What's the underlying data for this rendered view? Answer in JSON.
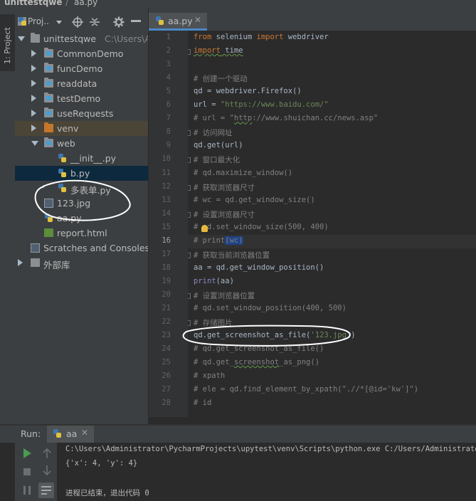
{
  "breadcrumb": {
    "project": "unittestqwe",
    "file": "aa.py"
  },
  "tool_strip": {
    "project_tab": "1: Project"
  },
  "project_panel": {
    "dropdown_label": "Proj..",
    "tree": [
      {
        "label": "unittestqwe",
        "sub": "C:\\Users\\Ad",
        "type": "folder",
        "level": 0,
        "expanded": true
      },
      {
        "label": "CommonDemo",
        "type": "package",
        "level": 1,
        "expanded": false
      },
      {
        "label": "funcDemo",
        "type": "package",
        "level": 1,
        "expanded": false
      },
      {
        "label": "readdata",
        "type": "package",
        "level": 1,
        "expanded": false
      },
      {
        "label": "testDemo",
        "type": "package",
        "level": 1,
        "expanded": false
      },
      {
        "label": "useRequests",
        "type": "package",
        "level": 1,
        "expanded": false
      },
      {
        "label": "venv",
        "type": "venv",
        "level": 1,
        "expanded": false
      },
      {
        "label": "web",
        "type": "package",
        "level": 1,
        "expanded": true
      },
      {
        "label": "__init__.py",
        "type": "py",
        "level": 2
      },
      {
        "label": "b.py",
        "type": "py",
        "level": 2,
        "selected": true
      },
      {
        "label": "多表单.py",
        "type": "py",
        "level": 2
      },
      {
        "label": "123.jpg",
        "type": "image",
        "level": 1
      },
      {
        "label": "aa.py",
        "type": "py",
        "level": 1
      },
      {
        "label": "report.html",
        "type": "html",
        "level": 1
      },
      {
        "label": "Scratches and Consoles",
        "type": "scratch",
        "level": 0
      },
      {
        "label": "外部库",
        "type": "lib",
        "level": 0,
        "expanded": false
      }
    ]
  },
  "editor": {
    "tab_label": "aa.py",
    "current_line": 16,
    "lines": [
      {
        "n": 1,
        "html": "<span class='kw'>from</span> selenium <span class='kw'>import</span> webdriver"
      },
      {
        "n": 2,
        "html": "<span class='kw typo'>import</span><span class='typo'> time</span>"
      },
      {
        "n": 3,
        "html": ""
      },
      {
        "n": 4,
        "html": "<span class='cm'># 创建一个驱动</span>"
      },
      {
        "n": 5,
        "html": "qd = webdriver.Firefox()"
      },
      {
        "n": 6,
        "html": "url = <span class='st'>\"https://www.baidu.com/\"</span>"
      },
      {
        "n": 7,
        "html": "<span class='cm'># url = \"<span class='typo'>http</span>://www.shuichan.cc/news.asp\"</span>"
      },
      {
        "n": 8,
        "html": "<span class='cm'># 访问网址</span>"
      },
      {
        "n": 9,
        "html": "qd.get(url)"
      },
      {
        "n": 10,
        "html": "<span class='cm'># 窗口最大化</span>"
      },
      {
        "n": 11,
        "html": "<span class='cm'># qd.maximize_window()</span>"
      },
      {
        "n": 12,
        "html": "<span class='cm'># 获取浏览器尺寸</span>"
      },
      {
        "n": 13,
        "html": "<span class='cm'># wc = qd.get_window_size()</span>"
      },
      {
        "n": 14,
        "html": "<span class='cm'># 设置浏览器尺寸</span>"
      },
      {
        "n": 15,
        "html": "<span class='cm'># qd.set_window_size(500, 400)</span>"
      },
      {
        "n": 16,
        "html": "<span class='cm'># print<span class='selword'>(wc)</span></span>"
      },
      {
        "n": 17,
        "html": "<span class='cm'># 获取当前浏览器位置</span>"
      },
      {
        "n": 18,
        "html": "aa = qd.get_window_position()"
      },
      {
        "n": 19,
        "html": "<span class='fn'>print</span>(aa)"
      },
      {
        "n": 20,
        "html": "<span class='cm'># 设置浏览器位置</span>"
      },
      {
        "n": 21,
        "html": "<span class='cm'># qd.set_window_position(400, 500)</span>"
      },
      {
        "n": 22,
        "html": "<span class='cm'># 存储图片</span>"
      },
      {
        "n": 23,
        "html": "qd.get_screenshot_as_file(<span class='st'>'123.jpg'</span>)"
      },
      {
        "n": 24,
        "html": "<span class='cm'># qd.get_screenshot_as_file()</span>"
      },
      {
        "n": 25,
        "html": "<span class='cm'># qd.get_<span class='typo'>screenshot</span>_as_png()</span>"
      },
      {
        "n": 26,
        "html": "<span class='cm'># xpath</span>"
      },
      {
        "n": 27,
        "html": "<span class='cm'># ele = qd.find_element_by_xpath(\".//*[@id='kw']\")</span>"
      },
      {
        "n": 28,
        "html": "<span class='cm'># id</span>"
      }
    ]
  },
  "run_panel": {
    "label": "Run:",
    "tab_label": "aa",
    "output": [
      "C:\\Users\\Administrator\\PycharmProjects\\upytest\\venv\\Scripts\\python.exe C:/Users/Administrator/Py",
      "{'x': 4, 'y': 4}",
      "",
      "进程已结束，退出代码 0"
    ]
  },
  "colors": {
    "background": "#2b2b2b",
    "panel": "#3c3f41",
    "selection": "#0d293e",
    "keyword": "#cc7832",
    "string": "#6a8759",
    "comment": "#808080"
  }
}
